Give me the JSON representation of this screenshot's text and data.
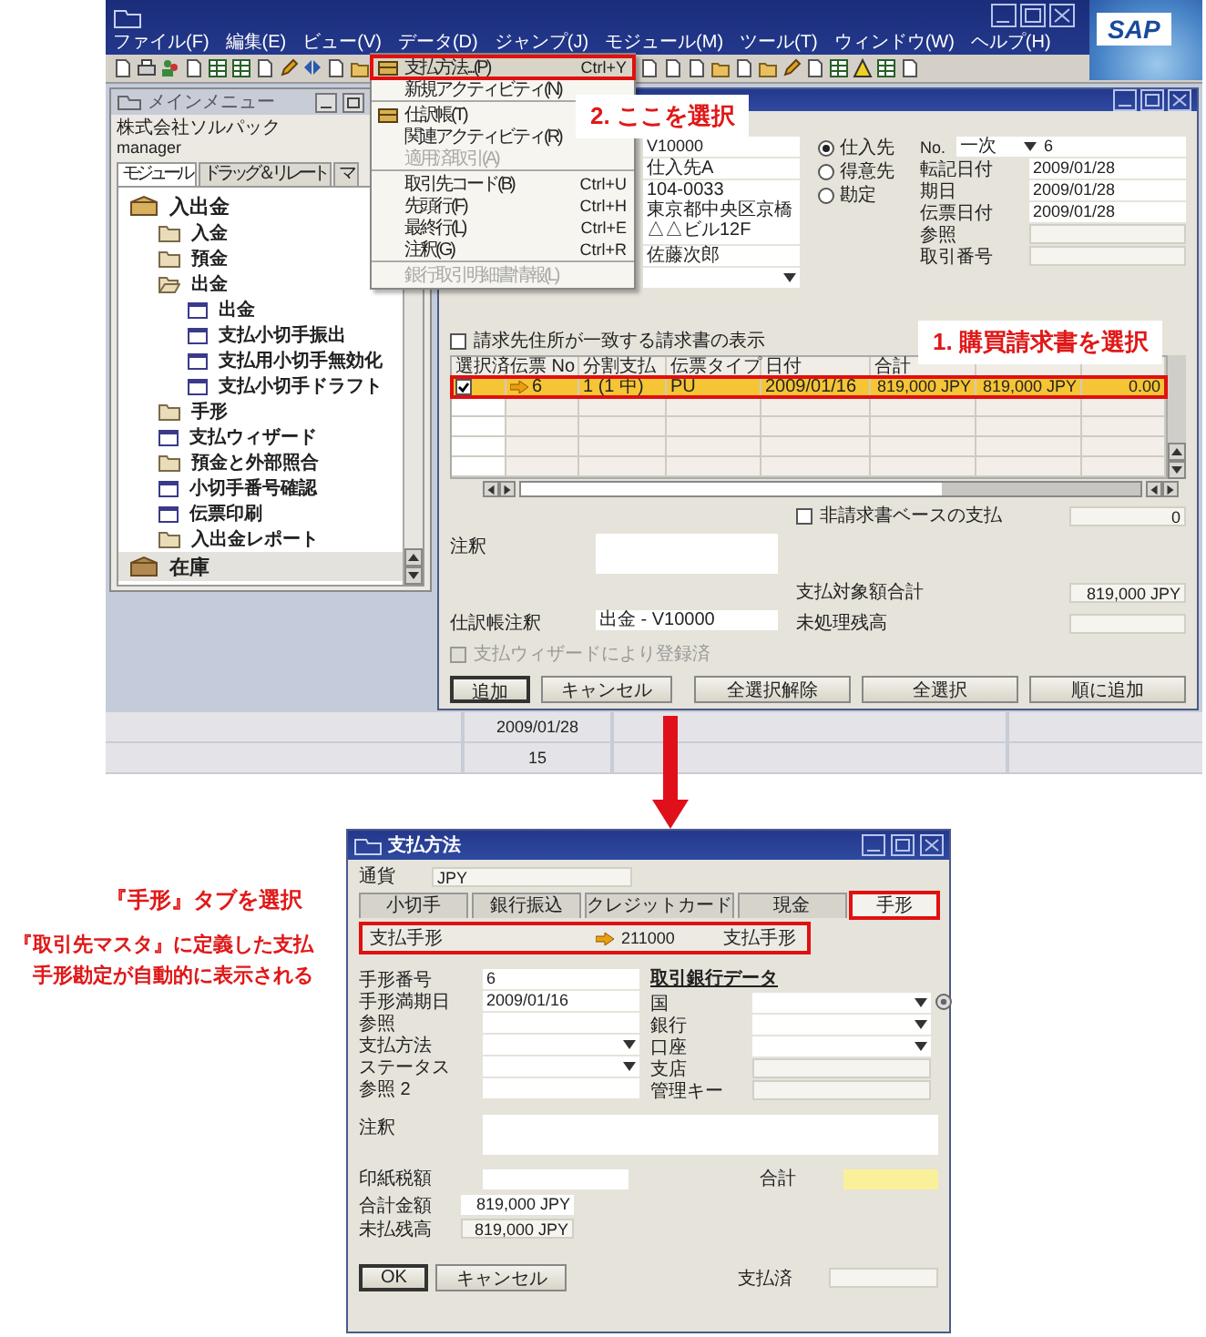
{
  "app": {
    "logo": "SAP",
    "menubar": [
      "ファイル(F)",
      "編集(E)",
      "ビュー(V)",
      "データ(D)",
      "ジャンプ(J)",
      "モジュール(M)",
      "ツール(T)",
      "ウィンドウ(W)",
      "ヘルプ(H)"
    ],
    "main_menu": {
      "title": "メインメニュー",
      "company": "株式会社ソルパック",
      "user": "manager",
      "tabs": [
        {
          "label": "モジュール",
          "selected": true
        },
        {
          "label": "ドラッグ＆リレート",
          "selected": false
        },
        {
          "label": "マ",
          "selected": false
        }
      ],
      "tree": [
        {
          "label": "入出金",
          "kind": "module",
          "expanded": true,
          "children": [
            {
              "label": "入金",
              "kind": "folder",
              "expanded": false
            },
            {
              "label": "預金",
              "kind": "folder",
              "expanded": false
            },
            {
              "label": "出金",
              "kind": "folder",
              "expanded": true,
              "children": [
                {
                  "label": "出金",
                  "kind": "form"
                },
                {
                  "label": "支払小切手振出",
                  "kind": "form"
                },
                {
                  "label": "支払用小切手無効化",
                  "kind": "form"
                },
                {
                  "label": "支払小切手ドラフト",
                  "kind": "form"
                }
              ]
            },
            {
              "label": "手形",
              "kind": "folder",
              "expanded": false
            },
            {
              "label": "支払ウィザード",
              "kind": "form"
            },
            {
              "label": "預金と外部照合",
              "kind": "folder",
              "expanded": false
            },
            {
              "label": "小切手番号確認",
              "kind": "form"
            },
            {
              "label": "伝票印刷",
              "kind": "form"
            },
            {
              "label": "入出金レポート",
              "kind": "folder",
              "expanded": false
            }
          ]
        },
        {
          "label": "在庫",
          "kind": "module",
          "expanded": false
        }
      ]
    },
    "context_menu": [
      {
        "label": "支払方法...(P)",
        "shortcut": "Ctrl+Y",
        "icon": true,
        "disabled": false,
        "selected": true,
        "separator_after": false
      },
      {
        "label": "新規アクティビティ(N)",
        "icon": false,
        "disabled": false,
        "selected": false,
        "separator_after": true
      },
      {
        "label": "仕訳帳(T)",
        "icon": true,
        "disabled": false,
        "selected": false,
        "separator_after": false
      },
      {
        "label": "関連アクティビティ(R)",
        "icon": false,
        "disabled": false,
        "selected": false,
        "separator_after": false
      },
      {
        "label": "適用済取引(A)",
        "icon": false,
        "disabled": true,
        "selected": false,
        "separator_after": true
      },
      {
        "label": "取引先コード(B)",
        "shortcut": "Ctrl+U",
        "icon": false,
        "disabled": false,
        "selected": false,
        "separator_after": false
      },
      {
        "label": "先頭行(F)",
        "shortcut": "Ctrl+H",
        "icon": false,
        "disabled": false,
        "selected": false,
        "separator_after": false
      },
      {
        "label": "最終行(L)",
        "shortcut": "Ctrl+E",
        "icon": false,
        "disabled": false,
        "selected": false,
        "separator_after": false
      },
      {
        "label": "注釈(G)",
        "shortcut": "Ctrl+R",
        "icon": false,
        "disabled": false,
        "selected": false,
        "separator_after": true
      },
      {
        "label": "銀行取引明細書情報(L)",
        "icon": false,
        "disabled": true,
        "selected": false,
        "separator_after": false
      }
    ],
    "payment": {
      "bp": {
        "code": "V10000",
        "name": "仕入先A",
        "address": [
          "104-0033",
          "東京都中央区京橋",
          "△△ビル12F"
        ],
        "contact": "佐藤次郎"
      },
      "bp_types": [
        {
          "label": "仕入先",
          "selected": true
        },
        {
          "label": "得意先",
          "selected": false
        },
        {
          "label": "勘定",
          "selected": false
        }
      ],
      "numbering": {
        "label": "No.",
        "series": "一次",
        "number": "6"
      },
      "dates": [
        {
          "label": "転記日付",
          "value": "2009/01/28"
        },
        {
          "label": "期日",
          "value": "2009/01/28"
        },
        {
          "label": "伝票日付",
          "value": "2009/01/28"
        },
        {
          "label": "参照"
        },
        {
          "label": "取引番号"
        }
      ],
      "filter": {
        "label": "請求先住所が一致する請求書の表示",
        "checked": false
      },
      "table": {
        "check_column": "選択済",
        "columns": [
          "伝票 No",
          "分割支払",
          "伝票タイプ",
          "日付",
          "合計"
        ],
        "rows": [
          {
            "checked": true,
            "selected": true,
            "cells": [
              "6",
              "1 (1 中)",
              "PU",
              "2009/01/16",
              "819,000 JPY",
              "819,000 JPY",
              "0.00"
            ]
          }
        ]
      },
      "non_invoice": {
        "label": "非請求書ベースの支払",
        "checked": false,
        "amount": "0"
      },
      "remarks_label": "注釈",
      "total": {
        "label": "支払対象額合計",
        "value": "819,000 JPY"
      },
      "journal_remarks": {
        "label": "仕訳帳注釈",
        "value": "出金 - V10000"
      },
      "open_balance": {
        "label": "未処理残高"
      },
      "wizard": {
        "label": "支払ウィザードにより登録済",
        "checked": false,
        "disabled": true
      },
      "buttons_left": [
        "追加",
        "キャンセル"
      ],
      "buttons_right": [
        "全選択解除",
        "全選択",
        "順に追加"
      ]
    },
    "status_bar": {
      "date": "2009/01/28",
      "time": "15"
    }
  },
  "dialog": {
    "title": "支払方法",
    "currency": {
      "label": "通貨",
      "value": "JPY"
    },
    "tabs": [
      {
        "label": "小切手",
        "selected": false
      },
      {
        "label": "銀行振込",
        "selected": false
      },
      {
        "label": "クレジットカード",
        "selected": false
      },
      {
        "label": "現金",
        "selected": false
      },
      {
        "label": "手形",
        "selected": true
      }
    ],
    "bill_account": {
      "label": "支払手形",
      "code": "211000",
      "name": "支払手形"
    },
    "left_fields": [
      {
        "label": "手形番号",
        "value": "6",
        "kind": "text"
      },
      {
        "label": "手形満期日",
        "value": "2009/01/16",
        "kind": "text"
      },
      {
        "label": "参照",
        "kind": "text"
      },
      {
        "label": "支払方法",
        "kind": "dropdown"
      },
      {
        "label": "ステータス",
        "kind": "dropdown"
      },
      {
        "label": "参照 2",
        "kind": "text"
      }
    ],
    "bank": {
      "title": "取引銀行データ",
      "fields": [
        {
          "label": "国",
          "kind": "dropdown"
        },
        {
          "label": "銀行",
          "kind": "dropdown"
        },
        {
          "label": "口座",
          "kind": "dropdown"
        },
        {
          "label": "支店",
          "kind": "readonly"
        },
        {
          "label": "管理キー",
          "kind": "readonly"
        }
      ]
    },
    "remarks_label": "注釈",
    "stamp_tax": {
      "label": "印紙税額"
    },
    "sum": {
      "label": "合計"
    },
    "amounts": [
      {
        "label": "合計金額",
        "value": "819,000 JPY"
      },
      {
        "label": "未払残高",
        "value": "819,000 JPY"
      }
    ],
    "buttons": [
      "OK",
      "キャンセル"
    ],
    "paid": {
      "label": "支払済"
    }
  },
  "callouts": {
    "step2": "2. ここを選択",
    "step1": "1. 購買請求書を選択",
    "tab_note": "『手形』タブを選択",
    "account_note": "『取引先マスタ』に定義した支払手形勘定が自動的に表示される"
  }
}
